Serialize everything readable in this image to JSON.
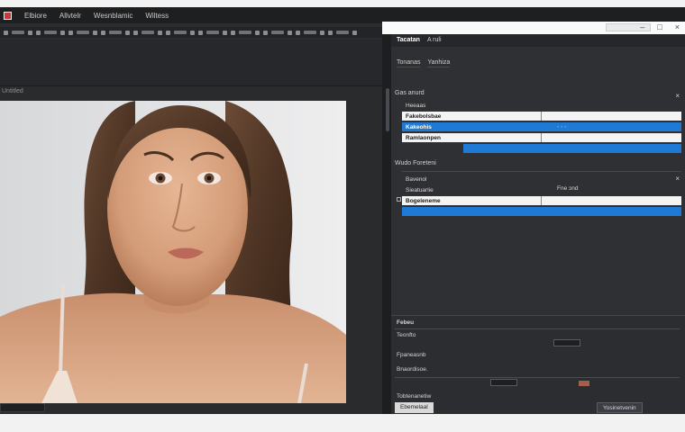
{
  "menubar": {
    "items": [
      "Elbiore",
      "Allvtelr",
      "Wesnblamic",
      "Wiltess"
    ]
  },
  "panels": {
    "tabs": [
      "Tacatan",
      "A ruli"
    ],
    "subtabs": [
      "Tonanas",
      "Yanhiza"
    ],
    "section1": {
      "title": "Gas anurd",
      "rows": [
        {
          "label": "Heeaas",
          "value": "",
          "style": "dark"
        },
        {
          "label": "Fakebolsbae",
          "value": "",
          "style": "white"
        },
        {
          "label": "Kakeohis",
          "value": "• • •",
          "style": "blue"
        },
        {
          "label": "Ramlaonpen",
          "value": "",
          "style": "white"
        },
        {
          "label": "",
          "value": "",
          "style": "blue"
        }
      ]
    },
    "section2": {
      "title": "Wudo Foreteni",
      "rows": [
        {
          "label": "Bavenol",
          "value": "",
          "style": "dark"
        },
        {
          "label": "Sieatuarlie",
          "value": "",
          "style": "dark"
        },
        {
          "label": "Bogeleneme",
          "value": "Fne ɔnd",
          "style": "white"
        },
        {
          "label": "",
          "value": "",
          "style": "blue"
        }
      ]
    },
    "lower": {
      "title": "Febeu",
      "lines": [
        "Teonfto",
        "Fpaneasnb",
        "Bnaordisoe.",
        "Tobtenanetiw"
      ],
      "button_left": "Ebemelaal",
      "button_right": "Yosinetvenin"
    }
  },
  "canvas": {
    "doc_label": "Untitled"
  },
  "colors": {
    "accent": "#1f7ad6",
    "panel": "#2f3033",
    "app_bg": "#2b2c2e"
  }
}
